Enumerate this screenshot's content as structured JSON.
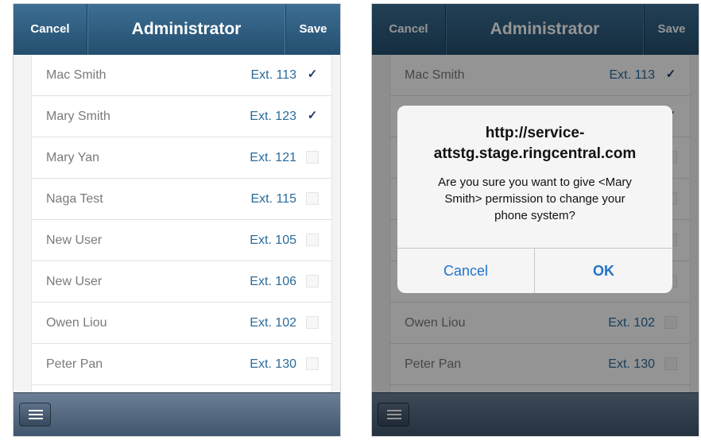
{
  "header": {
    "cancel_label": "Cancel",
    "title": "Administrator",
    "save_label": "Save"
  },
  "contacts": [
    {
      "name": "Mac Smith",
      "ext": "Ext. 113",
      "checked": true,
      "check": "✓"
    },
    {
      "name": "Mary Smith",
      "ext": "Ext. 123",
      "checked": true,
      "check": "✓"
    },
    {
      "name": "Mary Yan",
      "ext": "Ext. 121",
      "checked": false,
      "check": ""
    },
    {
      "name": "Naga Test",
      "ext": "Ext. 115",
      "checked": false,
      "check": ""
    },
    {
      "name": "New User",
      "ext": "Ext. 105",
      "checked": false,
      "check": ""
    },
    {
      "name": "New User",
      "ext": "Ext. 106",
      "checked": false,
      "check": ""
    },
    {
      "name": "Owen Liou",
      "ext": "Ext. 102",
      "checked": false,
      "check": ""
    },
    {
      "name": "Peter Pan",
      "ext": "Ext. 130",
      "checked": false,
      "check": ""
    }
  ],
  "dialog": {
    "title_line1": "http://service-",
    "title_line2": "attstg.stage.ringcentral.com",
    "message_line1": "Are you sure you want to give <Mary",
    "message_line2": "Smith> permission to change your",
    "message_line3": "phone system?",
    "cancel_label": "Cancel",
    "ok_label": "OK"
  },
  "footer": {
    "menu_icon": "hamburger-menu-icon"
  },
  "colors": {
    "header_top": "#3c6f94",
    "header_bottom": "#244e6e",
    "extension_text": "#2a6b9b",
    "dialog_button": "#1f73c9",
    "footer_top": "#6b7f96",
    "footer_bottom": "#40566d"
  }
}
